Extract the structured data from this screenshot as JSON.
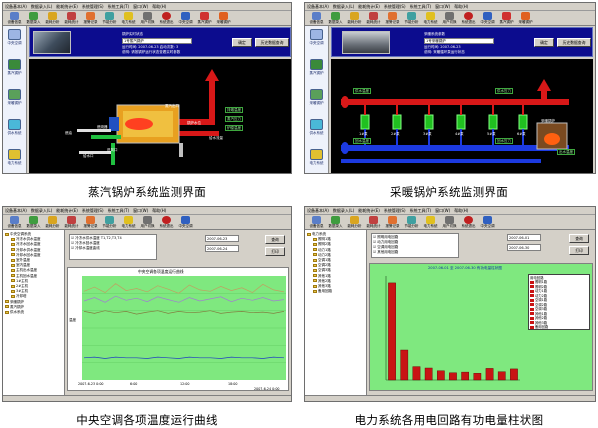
{
  "captions": {
    "steam": "蒸汽锅炉系统监测界面",
    "heating": "采暖锅炉系统监测界面",
    "hvac": "中央空调各项温度运行曲线",
    "power": "电力系统各用电回路有功电量柱状图"
  },
  "menu": [
    "设备基本(A)",
    "数据录入(L)",
    "能耗统计(E)",
    "系统管理(S)",
    "系统工具(T)",
    "窗口(W)",
    "帮助(H)"
  ],
  "toolbar": [
    "设备信息",
    "数据录入",
    "能耗分析",
    "能耗统计",
    "报警记录",
    "节能分析",
    "电力系统",
    "用户切换",
    "系统退出",
    "中央空调",
    "蒸汽锅炉",
    "采暖锅炉",
    "供水系统",
    "打印预览"
  ],
  "sidebar": [
    "中央空调",
    "蒸汽锅炉",
    "采暖锅炉",
    "供水系统",
    "电力系统",
    "监控录像"
  ],
  "steam": {
    "header_label": "锅炉实时状态",
    "select_value": "1号蒸汽锅炉",
    "info_line1": "运行时间: 2007-06-23  启动次数: 3",
    "info_line2": "说明: 请按锅炉运行状态查看实时参数",
    "ok_button": "确定",
    "hist_button": "历史数据查询",
    "labels": {
      "fuel": "燃油",
      "water_in": "给水口",
      "air_in": "进风口",
      "steam_out": "蒸汽出口",
      "water_level": "锅炉水位",
      "temp": "炉膛温度",
      "pressure": "蒸汽压力",
      "burner": "燃烧器",
      "exhaust": "排烟温度",
      "feed": "给水流量"
    }
  },
  "heating": {
    "header_label": "采暖系统参数",
    "select_value": "1号采暖锅炉",
    "info_line1": "运行时间: 2007-06-23",
    "info_line2": "说明: 采暖循环泵运行状态",
    "ok_button": "确定",
    "hist_button": "历史数据查询",
    "pipe_labels": [
      "供水温度",
      "供水压力",
      "回水温度",
      "回水压力"
    ],
    "pumps": [
      "1#泵",
      "2#泵",
      "3#泵",
      "4#泵",
      "5#泵",
      "6#泵"
    ],
    "boiler_label": "采暖锅炉",
    "outlet_label": "出水温度"
  },
  "hvac": {
    "tree_root": "中央空调系统",
    "tree_items": [
      "冷冻水供水温度",
      "冷冻水回水温度",
      "冷却水供水温度",
      "冷却水回水温度",
      "室外温度",
      "室内温度",
      "主机出水温度",
      "主机回水温度",
      "1#主机",
      "2#主机",
      "3#主机",
      "冷却塔",
      "采暖锅炉",
      "蒸汽锅炉",
      "供水系统"
    ],
    "options": [
      "冷冻水供水温度 T1,T2,T3,T4",
      "冷冻水回水温度",
      "冷却水温度曲线"
    ],
    "date_from": "2007-06-23",
    "date_to": "2007-06-24",
    "query_button": "查询",
    "print_button": "打印",
    "chart_title": "中央空调各项温度运行曲线",
    "y_label": "温度",
    "x_ticks": [
      "2007-6-23 0:00",
      "6:00",
      "12:00",
      "18:00",
      "2007-6-24 0:00"
    ]
  },
  "power": {
    "tree_root": "电力系统",
    "options": [
      "照明用电回路",
      "动力用电回路",
      "空调用电回路",
      "其他用电回路"
    ],
    "date_from": "2007-06-01",
    "date_to": "2007-06-30",
    "query_button": "查询",
    "print_button": "打印",
    "chart_title": "2007-06-01 至 2007-06-30 有功电量柱状图",
    "legend_title": "用电回路",
    "legend": [
      "照明1路",
      "照明2路",
      "动力1路",
      "动力2路",
      "空调1路",
      "空调2路",
      "空调3路",
      "其他1路",
      "其他2路",
      "其他3路",
      "备用回路"
    ],
    "y_label": "有功电量(kWh)"
  },
  "colors": {
    "monitor_bg": "#000000",
    "pipe_red": "#d81818",
    "pipe_blue": "#1c3ae0",
    "bar_red": "#c81414",
    "plot_green": "#7fe87f",
    "window_gray": "#d4d0c8"
  },
  "chart_data": [
    {
      "type": "line",
      "series": [
        {
          "values": [
            27.8,
            28.4,
            27.6,
            28.9,
            27.9,
            28.2,
            27.7,
            28.6,
            28.1,
            27.5,
            28.7,
            28.0,
            27.8,
            28.5,
            27.9,
            28.3,
            27.6,
            28.8,
            28.0,
            27.7
          ]
        },
        {
          "values": [
            26.4,
            26.9,
            26.2,
            27.1,
            26.5,
            26.8,
            26.3,
            27.0,
            26.6,
            26.2,
            26.9,
            26.4,
            26.7,
            27.0,
            26.3,
            26.8,
            26.5,
            26.9,
            26.4,
            26.6
          ]
        },
        {
          "values": [
            24.9,
            24.6,
            25.0,
            24.7,
            24.9,
            24.5,
            24.8,
            25.0,
            24.6,
            24.9,
            24.7,
            24.8,
            25.0,
            24.6,
            24.8,
            24.9,
            24.7,
            24.8,
            24.6,
            24.9
          ]
        },
        {
          "values": [
            18.2,
            18.3,
            18.1,
            18.3,
            18.2,
            18.2,
            18.1,
            18.3,
            18.2,
            18.1,
            18.3,
            18.2,
            18.2,
            18.1,
            18.3,
            18.2,
            18.2,
            18.1,
            18.3,
            18.2
          ]
        }
      ],
      "ylim": [
        15,
        30
      ]
    },
    {
      "type": "bar",
      "values": [
        4200,
        1300,
        580,
        520,
        400,
        310,
        340,
        290,
        500,
        360,
        480
      ],
      "ylim": [
        0,
        4500
      ]
    }
  ]
}
